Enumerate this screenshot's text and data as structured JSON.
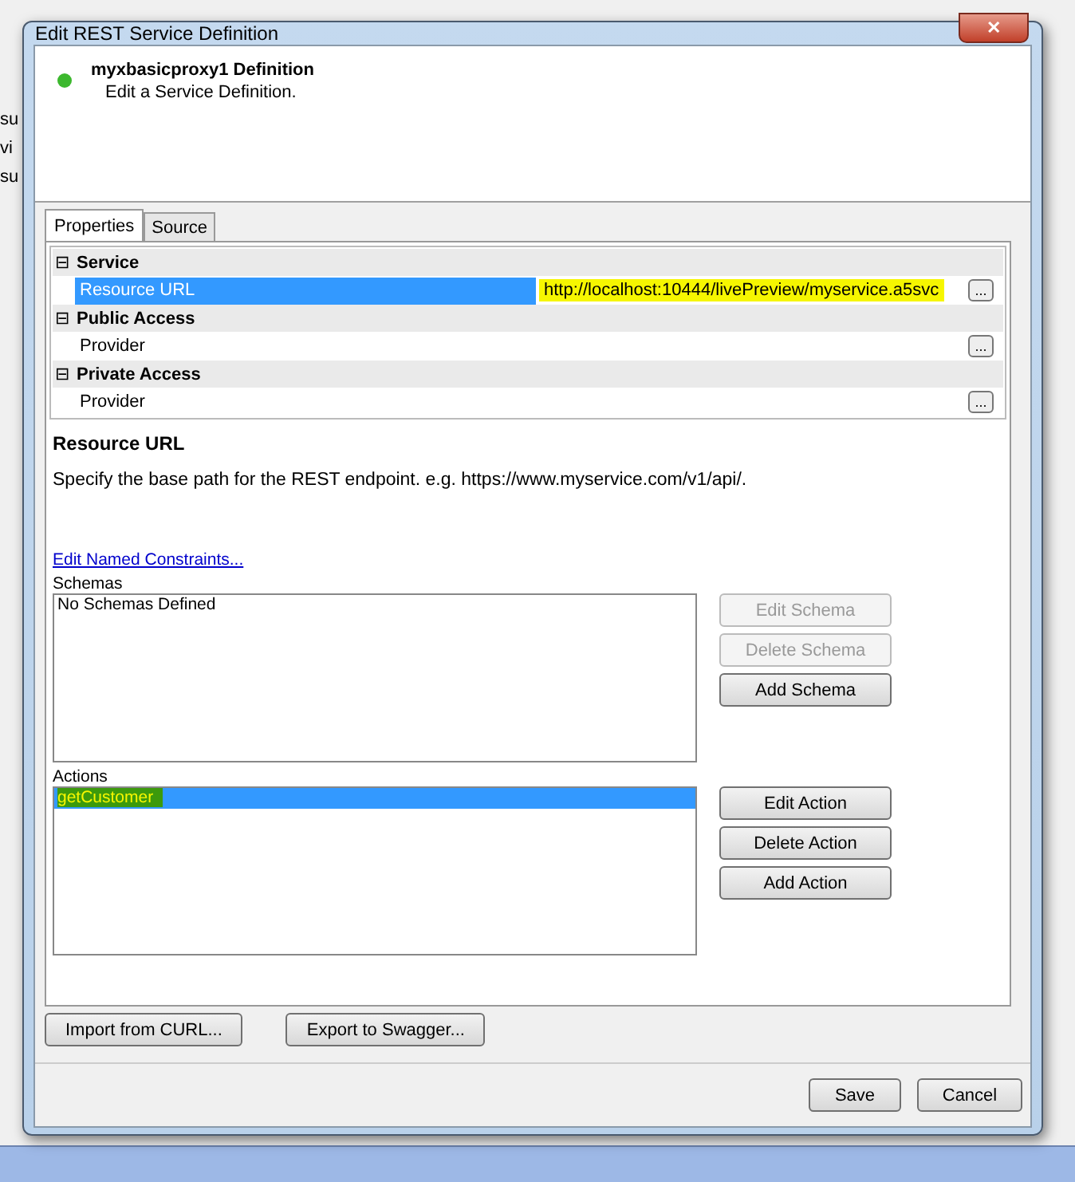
{
  "background_window": {
    "lines": [
      "su",
      "vi",
      "su"
    ]
  },
  "window": {
    "title": "Edit REST Service Definition",
    "close": "✕"
  },
  "header": {
    "active": true,
    "title": "myxbasicproxy1 Definition",
    "subtitle": "Edit a Service Definition."
  },
  "tabs": [
    {
      "label": "Properties",
      "selected": true
    },
    {
      "label": "Source",
      "selected": false
    }
  ],
  "property_grid": [
    {
      "category": "Service",
      "toggle": "⊟",
      "properties": [
        {
          "name": "Resource URL",
          "value": "http://localhost:10444/livePreview/myservice.a5svc",
          "selected": true,
          "highlighted": true,
          "button": "..."
        }
      ]
    },
    {
      "category": "Public Access",
      "toggle": "⊟",
      "properties": [
        {
          "name": "Provider",
          "selected": false,
          "button": "..."
        }
      ]
    },
    {
      "category": "Private Access",
      "toggle": "⊟",
      "properties": [
        {
          "name": "Provider",
          "selected": false,
          "button": "..."
        }
      ]
    }
  ],
  "description": {
    "title": "Resource URL",
    "text": "Specify the base path for the REST endpoint. e.g. https://www.myservice.com/v1/api/."
  },
  "link": "Edit Named Constraints...",
  "schemas": {
    "label": "Schemas",
    "items": [
      {
        "text": "No Schemas Defined",
        "selected": false,
        "highlighted": false
      }
    ],
    "buttons": [
      {
        "label": "Edit Schema",
        "disabled": true
      },
      {
        "label": "Delete Schema",
        "disabled": true
      },
      {
        "label": "Add Schema",
        "disabled": false
      }
    ]
  },
  "actions": {
    "label": "Actions",
    "items": [
      {
        "text": "getCustomer",
        "selected": true,
        "highlighted": true
      }
    ],
    "buttons": [
      {
        "label": "Edit Action",
        "disabled": false
      },
      {
        "label": "Delete Action",
        "disabled": false
      },
      {
        "label": "Add Action",
        "disabled": false
      }
    ]
  },
  "footer_buttons": [
    "Import from CURL...",
    "Export to Swagger..."
  ],
  "dialog_buttons": [
    "Save",
    "Cancel"
  ]
}
